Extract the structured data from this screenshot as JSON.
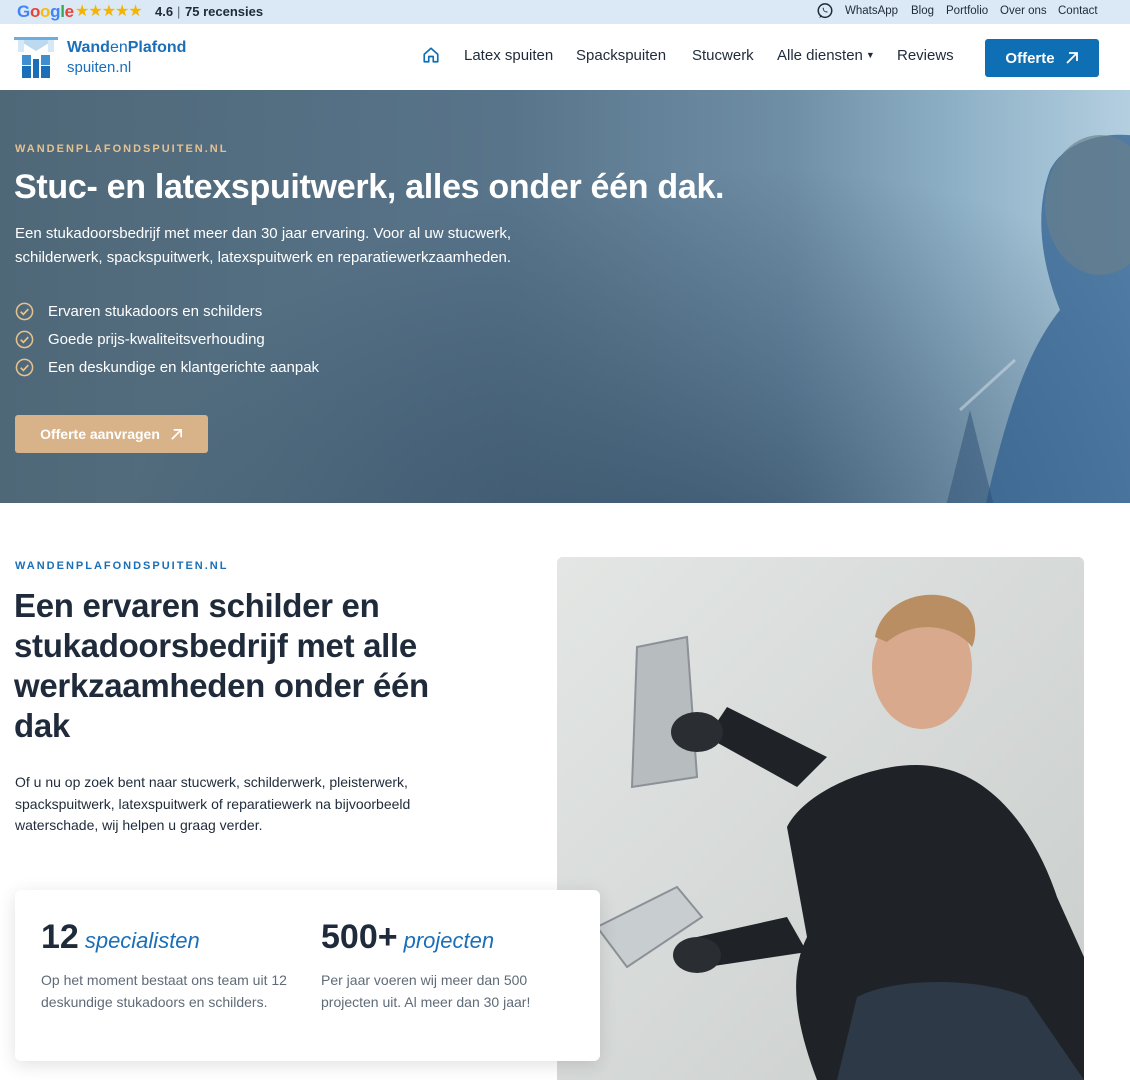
{
  "topbar": {
    "google_word": [
      "G",
      "o",
      "o",
      "g",
      "l",
      "e"
    ],
    "stars": "★★★★★",
    "rating": "4.6",
    "separator": "|",
    "reviews": "75 recensies",
    "links": [
      "WhatsApp",
      "Blog",
      "Portfolio",
      "Over ons",
      "Contact"
    ]
  },
  "logo": {
    "wand": "Wand",
    "en": "en",
    "plafond": "Plafond",
    "domain": "spuiten.nl"
  },
  "nav": {
    "items": [
      "Latex spuiten",
      "Spackspuiten",
      "Stucwerk",
      "Alle diensten",
      "Reviews"
    ],
    "cta": "Offerte"
  },
  "hero": {
    "eyebrow": "WANDENPLAFONDSPUITEN.NL",
    "title": "Stuc- en latexspuitwerk, alles onder één dak.",
    "subtitle": "Een stukadoorsbedrijf met meer dan 30 jaar ervaring. Voor al uw stucwerk, schilderwerk, spackspuitwerk, latexspuitwerk en reparatiewerkzaamheden.",
    "checks": [
      "Ervaren stukadoors en schilders",
      "Goede prijs-kwaliteitsverhouding",
      "Een deskundige en klantgerichte aanpak"
    ],
    "cta": "Offerte aanvragen"
  },
  "about": {
    "eyebrow": "WANDENPLAFONDSPUITEN.NL",
    "title": "Een ervaren schilder en stukadoorsbedrijf met alle werkzaamheden onder één dak",
    "text": "Of u nu op zoek bent naar stucwerk, schilderwerk, pleisterwerk, spackspuitwerk, latexspuitwerk of reparatiewerk na bijvoorbeeld waterschade, wij helpen u graag verder."
  },
  "stats": [
    {
      "number": "12",
      "word": "specialisten",
      "desc": "Op het moment bestaat ons team uit 12 deskundige stukadoors en schilders."
    },
    {
      "number": "500+",
      "word": "projecten",
      "desc": "Per jaar voeren wij meer dan 500 projecten uit. Al meer dan 30 jaar!"
    }
  ],
  "colors": {
    "primary": "#0f6fb5",
    "accent": "#d8b389",
    "topbar": "#dbe8f5",
    "dark_text": "#1f2b3a"
  },
  "icons": {
    "whatsapp": "whatsapp-icon",
    "home": "home-icon",
    "check": "check-circle-icon",
    "arrow": "arrow-up-right-icon",
    "caret": "chevron-down-icon"
  }
}
